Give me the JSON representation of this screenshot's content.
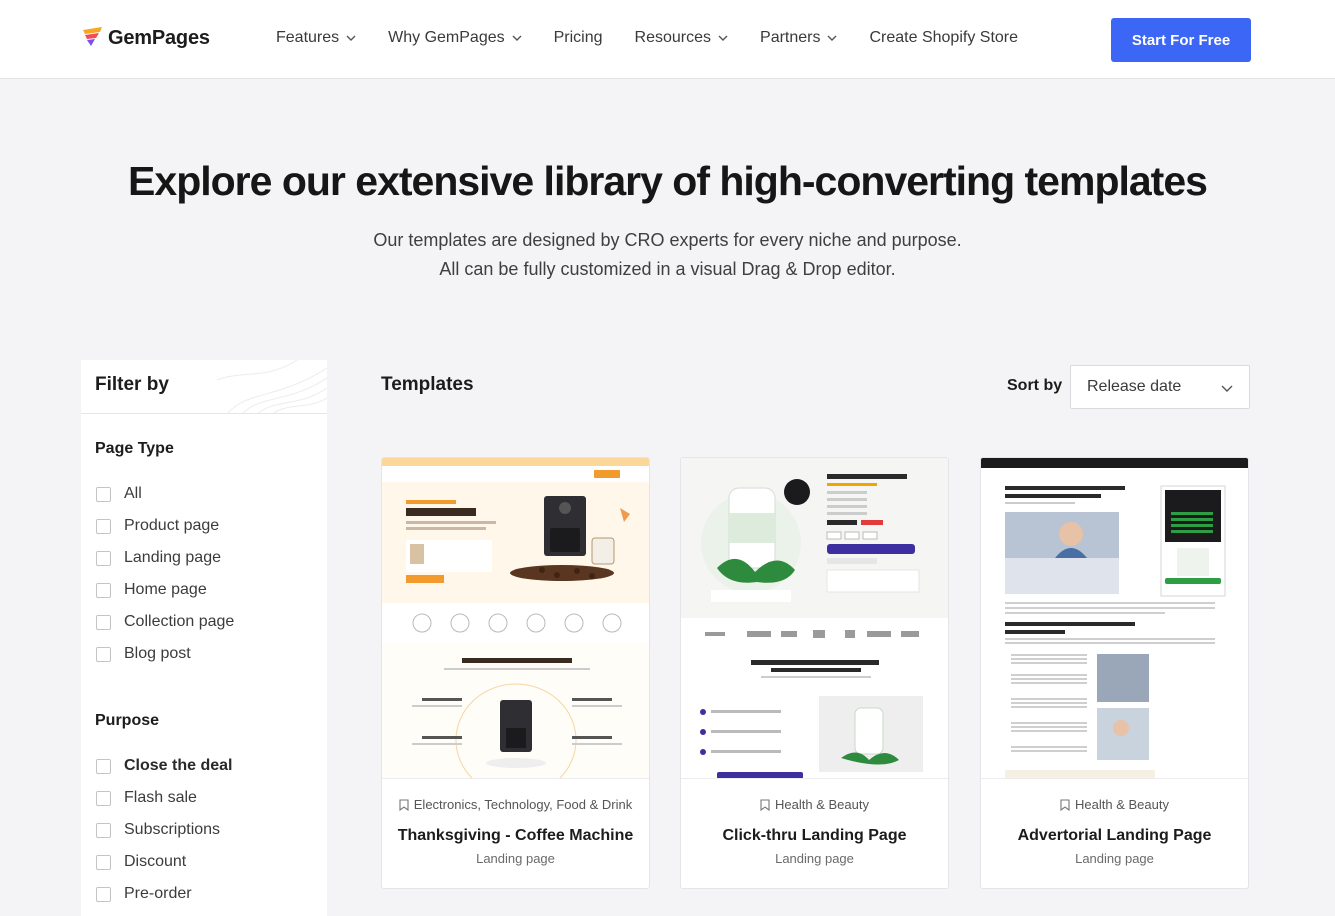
{
  "nav": {
    "logo_text": "GemPages",
    "menu": [
      {
        "label": "Features",
        "has_dropdown": true
      },
      {
        "label": "Why GemPages",
        "has_dropdown": true
      },
      {
        "label": "Pricing",
        "has_dropdown": false
      },
      {
        "label": "Resources",
        "has_dropdown": true
      },
      {
        "label": "Partners",
        "has_dropdown": true
      },
      {
        "label": "Create Shopify Store",
        "has_dropdown": false
      }
    ],
    "cta_label": "Start For Free"
  },
  "hero": {
    "title": "Explore our extensive library of high-converting templates",
    "subtitle_line1": "Our templates are designed by CRO experts for every niche and purpose.",
    "subtitle_line2": "All can be fully customized in a visual Drag & Drop editor."
  },
  "filter": {
    "title": "Filter by",
    "page_type": {
      "title": "Page Type",
      "options": [
        "All",
        "Product page",
        "Landing page",
        "Home page",
        "Collection page",
        "Blog post"
      ]
    },
    "purpose": {
      "title": "Purpose",
      "options": [
        "Close the deal",
        "Flash sale",
        "Subscriptions",
        "Discount",
        "Pre-order"
      ]
    }
  },
  "main": {
    "title": "Templates",
    "sort_label": "Sort by",
    "sort_value": "Release date"
  },
  "cards": [
    {
      "category": "Electronics, Technology, Food & Drink",
      "title": "Thanksgiving - Coffee Machine",
      "type": "Landing page"
    },
    {
      "category": "Health & Beauty",
      "title": "Click-thru Landing Page",
      "type": "Landing page"
    },
    {
      "category": "Health & Beauty",
      "title": "Advertorial Landing Page",
      "type": "Landing page"
    }
  ],
  "colors": {
    "accent": "#3c67f6",
    "page_bg": "#f4f4f6"
  }
}
